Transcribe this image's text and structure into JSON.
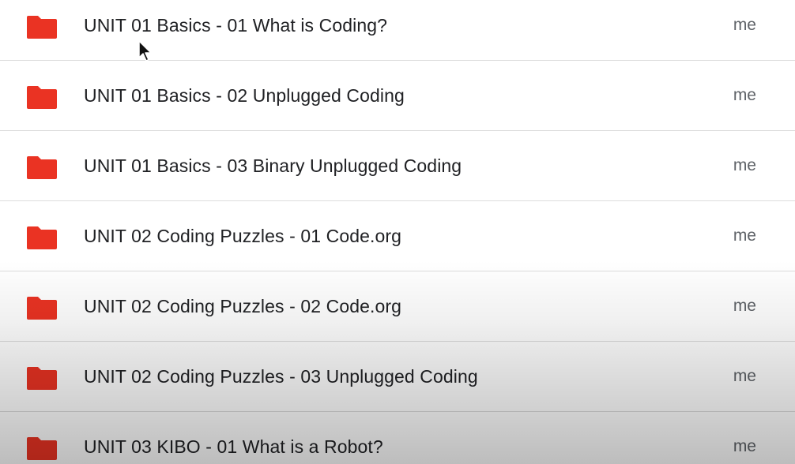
{
  "folder_color": "#ea3323",
  "owner_color": "#5f6368",
  "rows": [
    {
      "name": "UNIT 01 Basics - 01 What is Coding?",
      "owner": "me",
      "icon": "folder-icon"
    },
    {
      "name": "UNIT 01 Basics - 02 Unplugged Coding",
      "owner": "me",
      "icon": "folder-icon"
    },
    {
      "name": "UNIT 01 Basics - 03 Binary Unplugged Coding",
      "owner": "me",
      "icon": "folder-icon"
    },
    {
      "name": "UNIT 02 Coding Puzzles - 01 Code.org",
      "owner": "me",
      "icon": "folder-icon"
    },
    {
      "name": "UNIT 02 Coding Puzzles - 02 Code.org",
      "owner": "me",
      "icon": "folder-icon"
    },
    {
      "name": "UNIT 02 Coding Puzzles - 03 Unplugged Coding",
      "owner": "me",
      "icon": "folder-icon"
    },
    {
      "name": "UNIT 03 KIBO - 01 What is a Robot?",
      "owner": "me",
      "icon": "folder-icon"
    }
  ]
}
